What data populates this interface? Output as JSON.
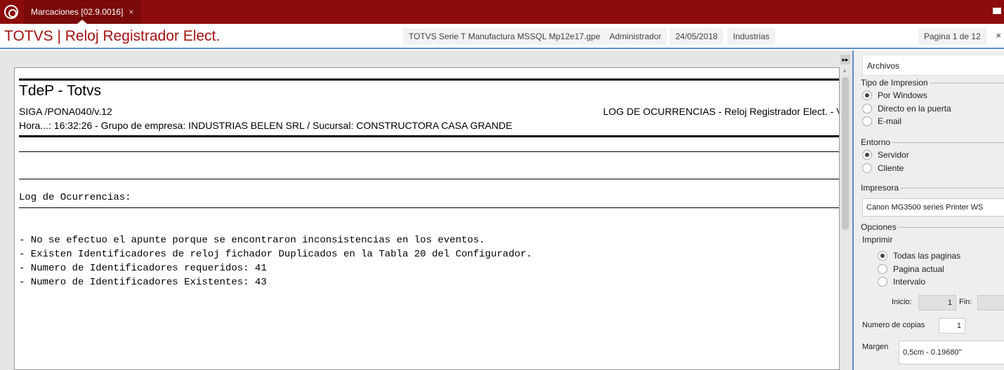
{
  "tab": {
    "label": "Marcaciones [02.9.0016]",
    "close": "×"
  },
  "header": {
    "title": "TOTVS | Reloj Registrador Elect.",
    "environment": "TOTVS Serie T Manufactura MSSQL Mp12e17.gpe",
    "user": "Administrador",
    "date": "24/05/2018",
    "company": "Industrias",
    "page": "Pagina 1 de 12",
    "close": "×"
  },
  "report": {
    "title": "TdeP - Totvs",
    "program": "SIGA /PONA040/v.12",
    "log_title": "LOG DE OCURRENCIAS - Reloj Registrador Elect. - V",
    "hour_line": "Hora...: 16:32:26 - Grupo de empresa: INDUSTRIAS BELEN SRL / Sucursal: CONSTRUCTORA CASA GRANDE",
    "section_label": "Log de Ocurrencias:",
    "lines": [
      "- No se efectuo el apunte porque se encontraron inconsistencias en los eventos.",
      "- Existen Identificadores de reloj fichador Duplicados en la Tabla 20 del Configurador.",
      "- Numero de Identificadores requeridos: 41",
      "- Numero de Identificadores Existentes: 43"
    ]
  },
  "side": {
    "archivos": "Archivos",
    "tipo_impresion": {
      "label": "Tipo de Impresion",
      "options": [
        "Por Windows",
        "Directo en la puerta",
        "E-mail"
      ],
      "selected": "Por Windows"
    },
    "entorno": {
      "label": "Entorno",
      "options": [
        "Servidor",
        "Cliente"
      ],
      "selected": "Servidor"
    },
    "impresora": {
      "label": "Impresora",
      "value": "Canon MG3500 series Printer WS"
    },
    "opciones": {
      "label": "Opciones",
      "imprimir_label": "Imprimir",
      "options": [
        "Todas las paginas",
        "Pagina actual",
        "Intervalo"
      ],
      "selected": "Todas las paginas",
      "inicio_label": "Inicio:",
      "inicio_value": "1",
      "fin_label": "Fin:",
      "fin_value": ""
    },
    "copias": {
      "label": "Numero de copias",
      "value": "1"
    },
    "margen": {
      "label": "Margen",
      "value": "0,5cm - 0.19680\""
    }
  },
  "icons": {
    "app_logo": "totvs-logo-icon",
    "mail": "mail-icon",
    "expand": "double-arrow-right-icon"
  },
  "colors": {
    "topbar": "#8c0c0c",
    "title_red": "#a51111",
    "accent_blue": "#5a8fc8"
  }
}
